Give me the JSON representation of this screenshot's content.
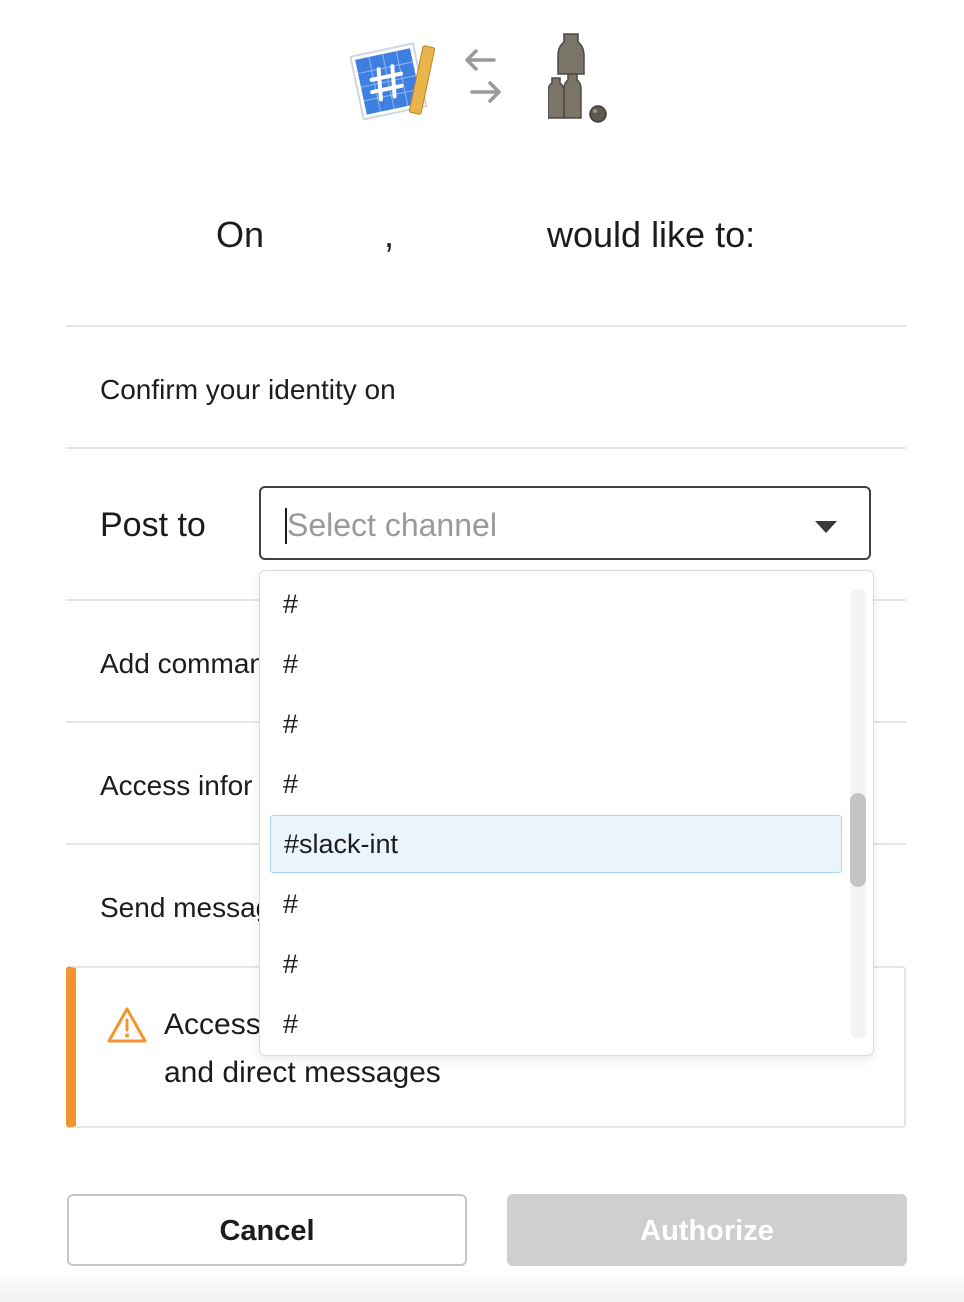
{
  "header": {
    "icons": [
      "blueprint-app-icon",
      "swap-arrows-icon",
      "workspace-bottles-icon"
    ],
    "on": "On",
    "comma": ",",
    "would_like_to": "would like to:"
  },
  "permissions": {
    "confirm_identity": "Confirm your identity on",
    "post_to_label": "Post to",
    "add_commands": "Add comman",
    "access_info": "Access infor",
    "send_messages": "Send messag"
  },
  "channel_select": {
    "placeholder": "Select channel",
    "options": [
      "#",
      "#",
      "#",
      "#",
      "#slack-int",
      "#",
      "#",
      "#"
    ],
    "highlighted_option": "#slack-int"
  },
  "warning": {
    "line1": "Access",
    "line2": "and direct messages",
    "accent_color": "#f2952f"
  },
  "buttons": {
    "cancel": "Cancel",
    "authorize": "Authorize"
  }
}
